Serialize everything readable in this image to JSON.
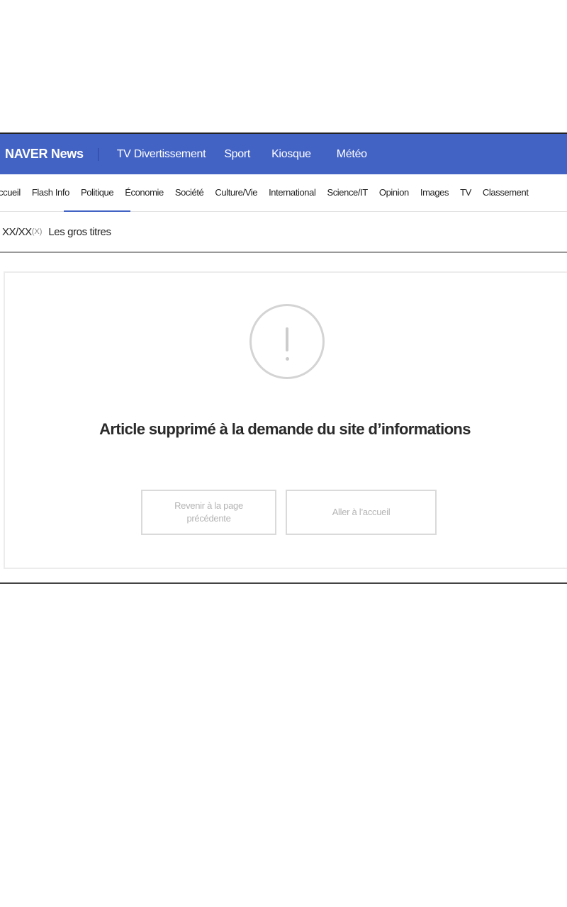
{
  "header": {
    "brand": "NAVER News",
    "nav": [
      "TV Divertissement",
      "Sport",
      "Kiosque",
      "Météo"
    ]
  },
  "subnav": {
    "items": [
      "ccueil",
      "Flash Info",
      "Politique",
      "Économie",
      "Société",
      "Culture/Vie",
      "International",
      "Science/IT",
      "Opinion",
      "Images",
      "TV",
      "Classement"
    ],
    "active": "Politique"
  },
  "dateline": {
    "date": "XX/XX",
    "day": "(X)",
    "section": "Les gros titres"
  },
  "notice": {
    "icon": "exclamation-circle-icon",
    "message": "Article supprimé à la demande du site d’informations",
    "back_label": "Revenir à la page précédente",
    "home_label": "Aller à l’accueil"
  },
  "colors": {
    "brand_blue": "#4262c4",
    "muted_text": "#b4b4b4",
    "border": "#dadada"
  }
}
